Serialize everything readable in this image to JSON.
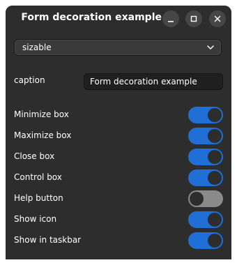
{
  "window": {
    "title": "Form decoration example"
  },
  "combo": {
    "selected": "sizable"
  },
  "caption": {
    "label": "caption",
    "value": "Form decoration example"
  },
  "options": [
    {
      "label": "Minimize box",
      "on": true
    },
    {
      "label": "Maximize box",
      "on": true
    },
    {
      "label": "Close box",
      "on": true
    },
    {
      "label": "Control box",
      "on": true
    },
    {
      "label": "Help button",
      "on": false
    },
    {
      "label": "Show icon",
      "on": true
    },
    {
      "label": "Show in taskbar",
      "on": true
    }
  ],
  "colors": {
    "accent": "#1f6fd6",
    "background": "#2d2d2d"
  },
  "icons": {
    "minimize": "minimize-icon",
    "maximize": "maximize-icon",
    "close": "close-icon",
    "dropdown": "chevron-down-icon"
  }
}
